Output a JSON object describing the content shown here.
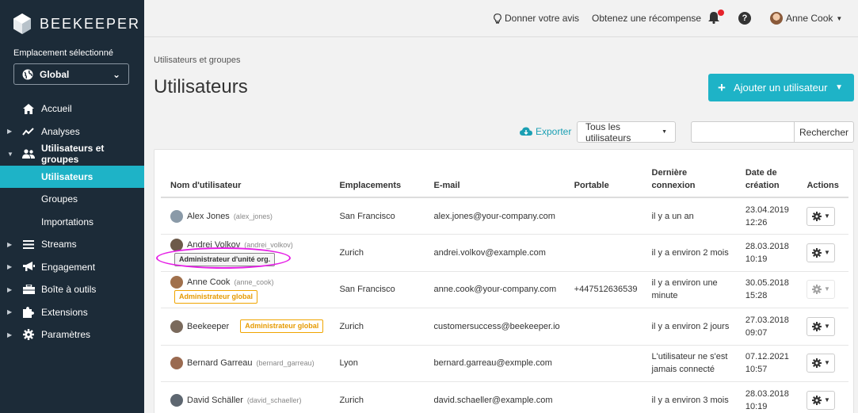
{
  "sidebar": {
    "brand": "BEEKEEPER",
    "location_label": "Emplacement sélectionné",
    "location_value": "Global",
    "items": [
      {
        "label": "Accueil",
        "icon": "home-icon",
        "caret": ""
      },
      {
        "label": "Analyses",
        "icon": "chart-line-icon",
        "caret": "▶"
      },
      {
        "label": "Utilisateurs et groupes",
        "icon": "users-icon",
        "caret": "▼"
      },
      {
        "label": "Utilisateurs",
        "icon": "",
        "caret": ""
      },
      {
        "label": "Groupes",
        "icon": "",
        "caret": ""
      },
      {
        "label": "Importations",
        "icon": "",
        "caret": ""
      },
      {
        "label": "Streams",
        "icon": "list-icon",
        "caret": "▶"
      },
      {
        "label": "Engagement",
        "icon": "megaphone-icon",
        "caret": "▶"
      },
      {
        "label": "Boîte à outils",
        "icon": "toolbox-icon",
        "caret": "▶"
      },
      {
        "label": "Extensions",
        "icon": "puzzle-icon",
        "caret": "▶"
      },
      {
        "label": "Paramètres",
        "icon": "gear-icon",
        "caret": "▶"
      }
    ]
  },
  "topbar": {
    "feedback": "Donner votre avis",
    "reward": "Obtenez une récompense",
    "help": "?",
    "user_name": "Anne Cook"
  },
  "main": {
    "breadcrumb": "Utilisateurs et groupes",
    "title": "Utilisateurs",
    "add_button": "Ajouter un utilisateur",
    "export": "Exporter",
    "filter": "Tous les utilisateurs",
    "search_placeholder": "",
    "search_button": "Rechercher"
  },
  "table": {
    "headers": [
      "Nom d'utilisateur",
      "Emplacements",
      "E-mail",
      "Portable",
      "Dernière connexion",
      "Date de création",
      "Actions"
    ],
    "rows": [
      {
        "name": "Alex Jones",
        "handle": "(alex_jones)",
        "badge": "",
        "badge_type": "",
        "location": "San Francisco",
        "email": "alex.jones@your-company.com",
        "mobile": "",
        "last_login": "il y a un an",
        "created_date": "23.04.2019",
        "created_time": "12:26",
        "avatar_color": "#8a9aa8",
        "actions_disabled": false
      },
      {
        "name": "Andrei Volkov",
        "handle": "(andrei_volkov)",
        "badge": "Administrateur d'unité org.",
        "badge_type": "org",
        "location": "Zurich",
        "email": "andrei.volkov@example.com",
        "mobile": "",
        "last_login": "il y a environ 2 mois",
        "created_date": "28.03.2018",
        "created_time": "10:19",
        "avatar_color": "#6d5a4a",
        "actions_disabled": false
      },
      {
        "name": "Anne Cook",
        "handle": "(anne_cook)",
        "badge": "Administrateur global",
        "badge_type": "global",
        "location": "San Francisco",
        "email": "anne.cook@your-company.com",
        "mobile": "+447512636539",
        "last_login": "il y a environ une minute",
        "created_date": "30.05.2018",
        "created_time": "15:28",
        "avatar_color": "#a0704c",
        "actions_disabled": true
      },
      {
        "name": "Beekeeper",
        "handle": "",
        "badge": "Administrateur global",
        "badge_type": "global",
        "location": "Zurich",
        "email": "customersuccess@beekeeper.io",
        "mobile": "",
        "last_login": "il y a environ 2 jours",
        "created_date": "27.03.2018",
        "created_time": "09:07",
        "avatar_color": "#7a6a5c",
        "actions_disabled": false
      },
      {
        "name": "Bernard Garreau",
        "handle": "(bernard_garreau)",
        "badge": "",
        "badge_type": "",
        "location": "Lyon",
        "email": "bernard.garreau@exmple.com",
        "mobile": "",
        "last_login": "L'utilisateur ne s'est jamais connecté",
        "created_date": "07.12.2021",
        "created_time": "10:57",
        "avatar_color": "#9a6a50",
        "actions_disabled": false
      },
      {
        "name": "David Schäller",
        "handle": "(david_schaeller)",
        "badge": "",
        "badge_type": "",
        "location": "Zurich",
        "email": "david.schaeller@example.com",
        "mobile": "",
        "last_login": "il y a environ 3 mois",
        "created_date": "28.03.2018",
        "created_time": "10:19",
        "avatar_color": "#5d6670",
        "actions_disabled": false
      }
    ]
  },
  "colors": {
    "sidebar_bg": "#1c2b38",
    "accent": "#1eb3c7",
    "badge_global": "#f0a500",
    "highlight": "#e61ee6",
    "notification": "#e5232b"
  }
}
